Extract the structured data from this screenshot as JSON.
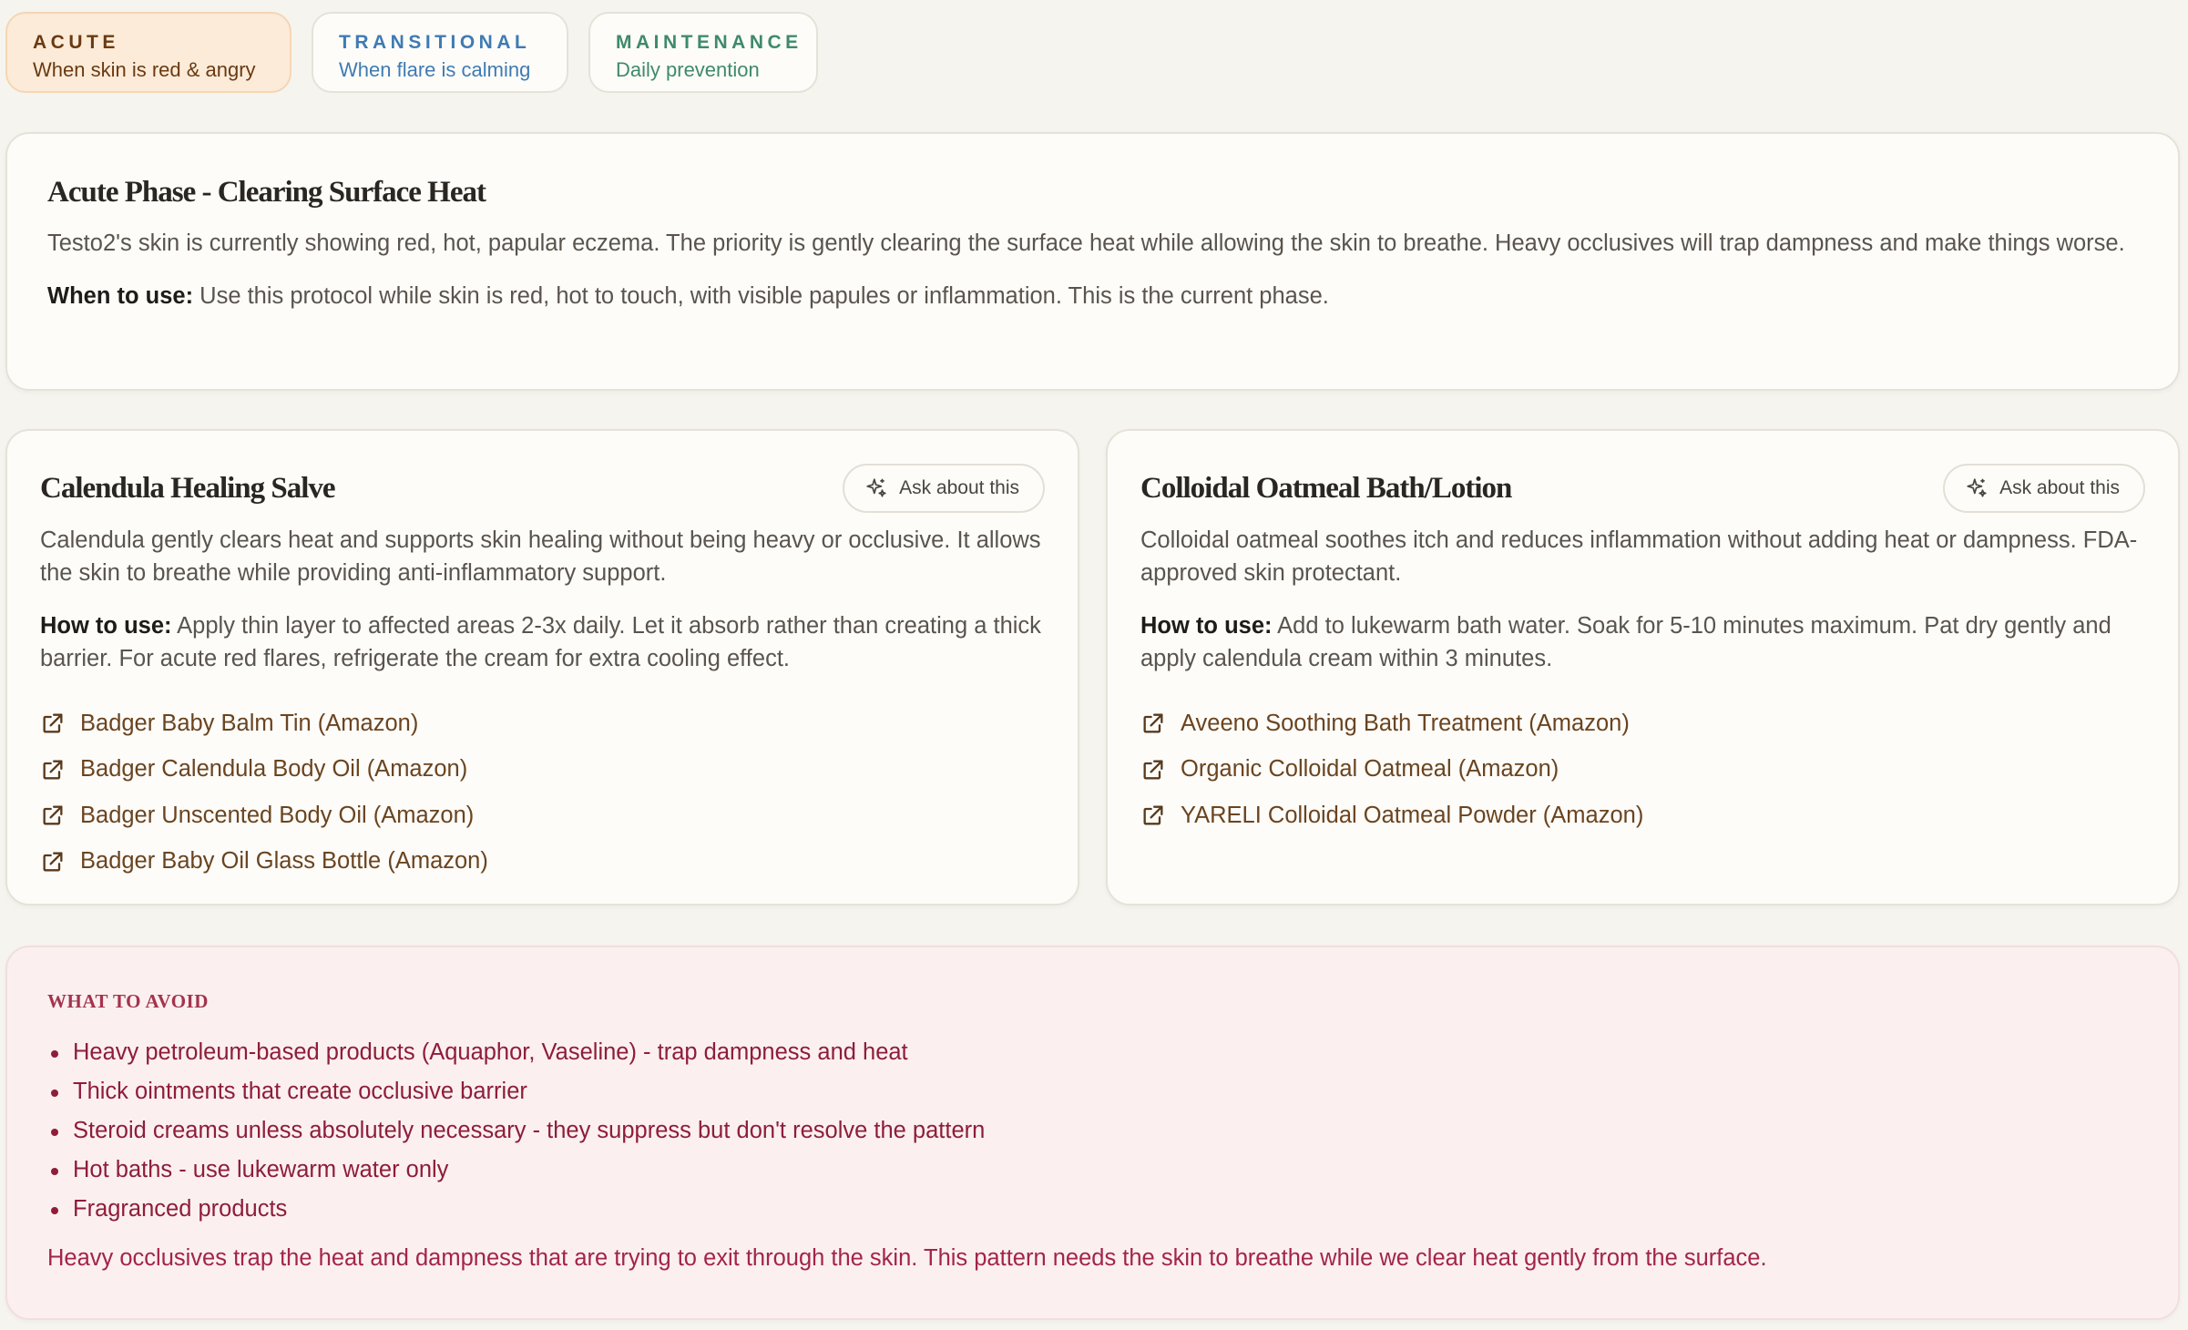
{
  "phases": [
    {
      "name": "ACUTE",
      "subtitle": "When skin is red & angry"
    },
    {
      "name": "TRANSITIONAL",
      "subtitle": "When flare is calming"
    },
    {
      "name": "MAINTENANCE",
      "subtitle": "Daily prevention"
    }
  ],
  "intro": {
    "title": "Acute Phase - Clearing Surface Heat",
    "description": "Testo2's skin is currently showing red, hot, papular eczema. The priority is gently clearing the surface heat while allowing the skin to breathe. Heavy occlusives will trap dampness and make things worse.",
    "when_label": "When to use:",
    "when_text": " Use this protocol while skin is red, hot to touch, with visible papules or inflammation. This is the current phase."
  },
  "products": [
    {
      "title": "Calendula Healing Salve",
      "ask_label": "Ask about this",
      "description": "Calendula gently clears heat and supports skin healing without being heavy or occlusive. It allows the skin to breathe while providing anti-inflammatory support.",
      "howto_label": "How to use:",
      "howto_text": " Apply thin layer to affected areas 2-3x daily. Let it absorb rather than creating a thick barrier. For acute red flares, refrigerate the cream for extra cooling effect.",
      "links": [
        "Badger Baby Balm Tin (Amazon)",
        "Badger Calendula Body Oil (Amazon)",
        "Badger Unscented Body Oil (Amazon)",
        "Badger Baby Oil Glass Bottle (Amazon)"
      ]
    },
    {
      "title": "Colloidal Oatmeal Bath/Lotion",
      "ask_label": "Ask about this",
      "description": "Colloidal oatmeal soothes itch and reduces inflammation without adding heat or dampness. FDA-approved skin protectant.",
      "howto_label": "How to use:",
      "howto_text": " Add to lukewarm bath water. Soak for 5-10 minutes maximum. Pat dry gently and apply calendula cream within 3 minutes.",
      "links": [
        "Aveeno Soothing Bath Treatment (Amazon)",
        "Organic Colloidal Oatmeal (Amazon)",
        "YARELI Colloidal Oatmeal Powder (Amazon)"
      ]
    }
  ],
  "avoid": {
    "title": "WHAT TO AVOID",
    "items": [
      "Heavy petroleum-based products (Aquaphor, Vaseline) - trap dampness and heat",
      "Thick ointments that create occlusive barrier",
      "Steroid creams unless absolutely necessary - they suppress but don't resolve the pattern",
      "Hot baths - use lukewarm water only",
      "Fragranced products"
    ],
    "note": "Heavy occlusives trap the heat and dampness that are trying to exit through the skin. This pattern needs the skin to breathe while we clear heat gently from the surface."
  },
  "icons": {
    "ask": "sparkles-icon",
    "link": "external-link-icon"
  },
  "colors": {
    "acute_bg": "#fcebd8",
    "acute_text": "#6a3a12",
    "transitional_text": "#3f7bb3",
    "maintenance_text": "#3f8a6c",
    "link_text": "#6a4420",
    "avoid_bg": "#fbf0ef",
    "avoid_text": "#8e1d3a"
  }
}
